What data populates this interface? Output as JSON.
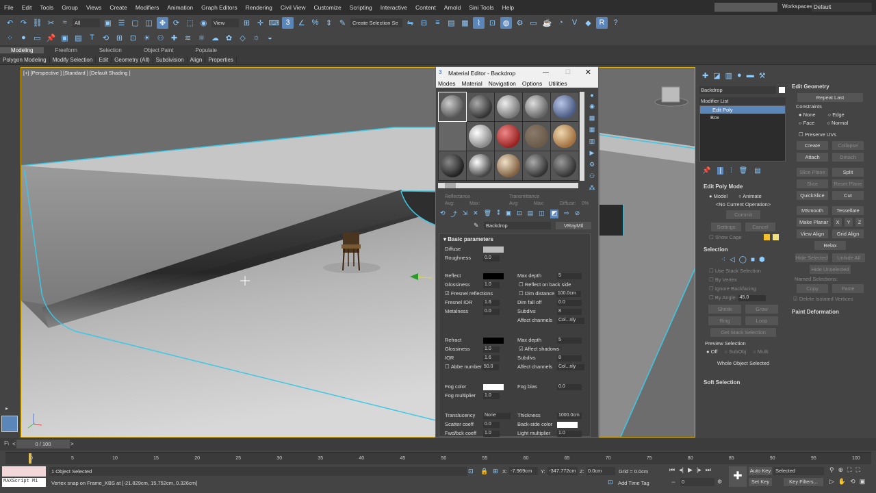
{
  "menu": [
    "File",
    "Edit",
    "Tools",
    "Group",
    "Views",
    "Create",
    "Modifiers",
    "Animation",
    "Graph Editors",
    "Rendering",
    "Civil View",
    "Customize",
    "Scripting",
    "Interactive",
    "Content",
    "Arnold",
    "Sini Tools",
    "Help"
  ],
  "workspace": {
    "label": "Workspaces:",
    "value": "Default"
  },
  "toolbar": {
    "filter": "All",
    "view": "View",
    "create_selection": "Create Selection Se"
  },
  "ribbon_tabs": [
    "Modeling",
    "Freeform",
    "Selection",
    "Object Paint",
    "Populate"
  ],
  "ribbon_sub": [
    "Polygon Modeling",
    "Modify Selection",
    "Edit",
    "Geometry (All)",
    "Subdivision",
    "Align",
    "Properties"
  ],
  "viewport_label": "[+] [Perspective ] [Standard ] [Default Shading ]",
  "material_editor": {
    "title": "Material Editor - Backdrop",
    "menu": [
      "Modes",
      "Material",
      "Navigation",
      "Options",
      "Utilities"
    ],
    "refl_labels": {
      "reflectance": "Reflectance",
      "transmittance": "Transmittance",
      "avg": "Avg:",
      "max": "Max:",
      "diffuse": "Diffuse:",
      "diffuse_val": "0%"
    },
    "material_name": "Backdrop",
    "material_type": "VRayMtl",
    "basic_params": "Basic parameters",
    "diffuse": "Diffuse",
    "roughness": "Roughness",
    "roughness_val": "0.0",
    "reflect": "Reflect",
    "max_depth": "Max depth",
    "max_depth_val": "5",
    "glossiness": "Glossiness",
    "gloss_val": "1.0",
    "reflect_back": "Reflect on back side",
    "fresnel": "Fresnel reflections",
    "dim_distance": "Dim distance",
    "dim_val": "100.0cm",
    "fresnel_ior": "Fresnel IOR",
    "fresnel_ior_val": "1.6",
    "dim_falloff": "Dim fall off",
    "dim_falloff_val": "0.0",
    "subdivs": "Subdivs",
    "subdivs_val": "8",
    "metalness": "Metalness",
    "metal_val": "0.0",
    "affect_channels": "Affect channels",
    "affect_val": "Col...nly",
    "refract": "Refract",
    "refract_depth_val": "5",
    "refract_gloss_val": "1.0",
    "affect_shadows": "Affect shadows",
    "ior": "IOR",
    "ior_val": "1.6",
    "refract_subdivs_val": "8",
    "abbe": "Abbe number",
    "abbe_val": "50.0",
    "fog_color": "Fog color",
    "fog_bias": "Fog bias",
    "fog_bias_val": "0.0",
    "fog_mult": "Fog multiplier",
    "fog_mult_val": "1.0",
    "translucency": "Translucency",
    "transl_val": "None",
    "thickness": "Thickness",
    "thickness_val": "1000.0cm",
    "scatter": "Scatter coeff",
    "scatter_val": "0.0",
    "backside": "Back-side color",
    "fwd": "Fwd/bck coeff",
    "fwd_val": "1.0",
    "light_mult": "Light multiplier",
    "light_mult_val": "1.0"
  },
  "command_panel": {
    "object_name": "Backdrop",
    "modifier_list": "Modifier List",
    "stack": [
      "Edit Poly",
      "Box"
    ],
    "edit_poly_mode": "Edit Poly Mode",
    "model": "Model",
    "animate": "Animate",
    "no_op": "<No Current Operation>",
    "commit": "Commit",
    "settings": "Settings",
    "cancel": "Cancel",
    "show_cage": "Show Cage",
    "selection": "Selection",
    "use_stack": "Use Stack Selection",
    "by_vertex": "By Vertex",
    "ignore_backfacing": "Ignore Backfacing",
    "by_angle": "By Angle:",
    "angle_val": "45.0",
    "shrink": "Shrink",
    "grow": "Grow",
    "ring": "Ring",
    "loop": "Loop",
    "get_stack": "Get Stack Selection",
    "preview": "Preview Selection",
    "off": "Off",
    "subobj": "SubObj",
    "multi": "Multi",
    "whole": "Whole Object Selected",
    "soft": "Soft Selection"
  },
  "edit_geometry": {
    "title": "Edit Geometry",
    "repeat": "Repeat Last",
    "constraints": "Constraints",
    "none": "None",
    "edge": "Edge",
    "face": "Face",
    "normal": "Normal",
    "preserve": "Preserve UVs",
    "create": "Create",
    "collapse": "Collapse",
    "attach": "Attach",
    "detach": "Detach",
    "slice_plane": "Slice Plane",
    "split": "Split",
    "slice": "Slice",
    "reset_plane": "Reset Plane",
    "quickslice": "QuickSlice",
    "cut": "Cut",
    "msmooth": "MSmooth",
    "tessellate": "Tessellate",
    "make_planar": "Make Planar",
    "x": "X",
    "y": "Y",
    "z": "Z",
    "view_align": "View Align",
    "grid_align": "Grid Align",
    "relax": "Relax",
    "hide_sel": "Hide Selected",
    "unhide": "Unhide All",
    "hide_unsel": "Hide Unselected",
    "named": "Named Selections:",
    "copy": "Copy",
    "paste": "Paste",
    "delete_iso": "Delete Isolated Vertices",
    "paint_def": "Paint Deformation"
  },
  "timeline": {
    "frame": "0 / 100",
    "ticks": [
      "0",
      "5",
      "10",
      "15",
      "20",
      "25",
      "30",
      "35",
      "40",
      "45",
      "50",
      "55",
      "60",
      "65",
      "70",
      "75",
      "80",
      "85",
      "90",
      "95",
      "100"
    ]
  },
  "status": {
    "selected": "1 Object Selected",
    "prompt": "Vertex snap on Frame_KBS at [-21.829cm, 15.752cm, 0.326cm]",
    "x": "-7.969cm",
    "y": "-347.772cm",
    "z": "0.0cm",
    "grid": "Grid = 0.0cm",
    "add_time_tag": "Add Time Tag",
    "auto_key": "Auto Key",
    "selected_dd": "Selected",
    "set_key": "Set Key",
    "key_filters": "Key Filters...",
    "frame_field": "0",
    "maxscript": "MAXScript Mi"
  }
}
